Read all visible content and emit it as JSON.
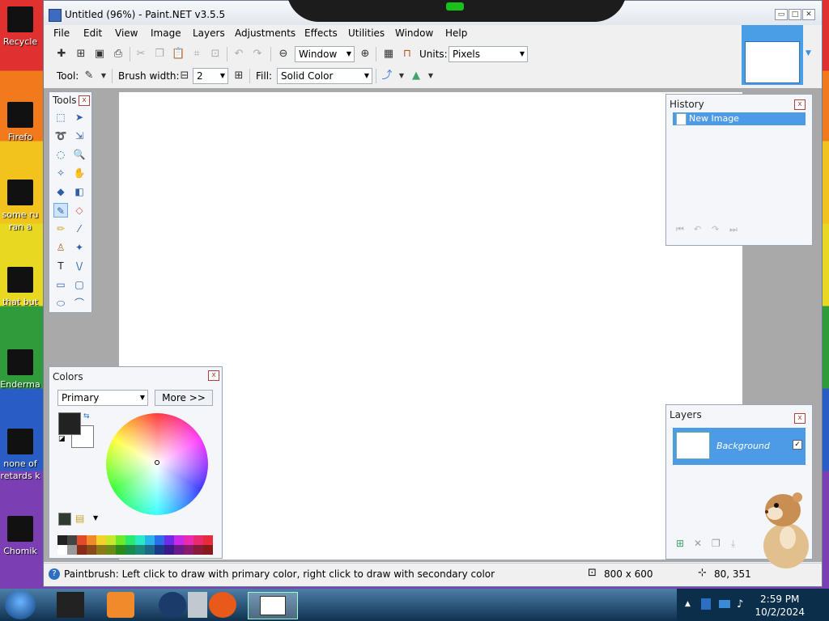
{
  "desktop": {
    "icons": [
      {
        "label": "Recycle"
      },
      {
        "label": "Firefo"
      },
      {
        "label": "some ru",
        "label2": "ran a"
      },
      {
        "label": "that but"
      },
      {
        "label": "Enderma"
      },
      {
        "label": "none of",
        "label2": "retards k"
      },
      {
        "label": "Chomik"
      }
    ]
  },
  "window": {
    "title": "Untitled (96%) - Paint.NET v3.5.5",
    "controls": {
      "minimize": "▭",
      "restore": "□",
      "close": "✕"
    }
  },
  "menu": [
    "File",
    "Edit",
    "View",
    "Image",
    "Layers",
    "Adjustments",
    "Effects",
    "Utilities",
    "Window",
    "Help"
  ],
  "toolbar": {
    "zoom_value": "Window",
    "units_label": "Units:",
    "units_value": "Pixels",
    "tool_label": "Tool:",
    "brush_width_label": "Brush width:",
    "brush_width_value": "2",
    "fill_label": "Fill:",
    "fill_value": "Solid Color"
  },
  "tools_panel": {
    "title": "Tools",
    "close": "x"
  },
  "history_panel": {
    "title": "History",
    "close": "x",
    "items": [
      "New Image"
    ]
  },
  "colors_panel": {
    "title": "Colors",
    "close": "x",
    "mode": "Primary",
    "more_label": "More >>",
    "primary_color": "#222222",
    "secondary_color": "#ffffff"
  },
  "layers_panel": {
    "title": "Layers",
    "close": "x",
    "layers": [
      {
        "name": "Background",
        "visible": true
      }
    ]
  },
  "status": {
    "text": "Paintbrush: Left click to draw with primary color, right click to draw with secondary color",
    "image_size": "800 x 600",
    "cursor_pos": "80, 351"
  },
  "taskbar": {
    "time": "2:59 PM",
    "date": "10/2/2024"
  }
}
